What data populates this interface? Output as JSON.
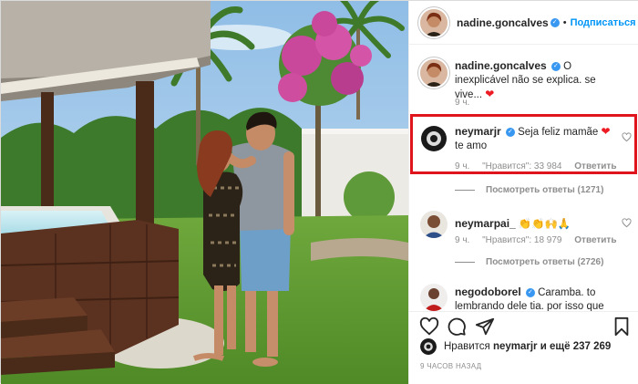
{
  "header": {
    "username": "nadine.goncalves",
    "follow_label": "Подписаться"
  },
  "comments": [
    {
      "username": "nadine.goncalves",
      "text": "O inexplicável não se explica. se vive...",
      "emoji": "❤",
      "time": "9 ч."
    },
    {
      "username": "neymarjr",
      "text": "Seja feliz mamãe",
      "text2": "te amo",
      "emoji": "❤",
      "time": "9 ч.",
      "likes": "\"Нравится\": 33 984",
      "reply": "Ответить",
      "view_replies": "Посмотреть ответы (1271)"
    },
    {
      "username": "neymarpai_",
      "emoji": "👏👏🙌🙏",
      "time": "9 ч.",
      "likes": "\"Нравится\": 18 979",
      "reply": "Ответить",
      "view_replies": "Посмотреть ответы (2726)"
    },
    {
      "username": "negodoborel",
      "text": "Caramba. to lembrando dele tia. por isso que"
    }
  ],
  "footer": {
    "likes_prefix": "Нравится",
    "likes_user": "neymarjr",
    "likes_suffix": "и ещё 237 269",
    "time_ago": "9 ЧАСОВ НАЗАД"
  },
  "colors": {
    "accent": "#0095f6",
    "highlight": "#e0141c",
    "verified": "#3897f0",
    "secondary_text": "#8e8e8e"
  },
  "icons": [
    "verified-badge-icon",
    "heart-icon",
    "comment-icon",
    "share-icon",
    "bookmark-icon"
  ]
}
